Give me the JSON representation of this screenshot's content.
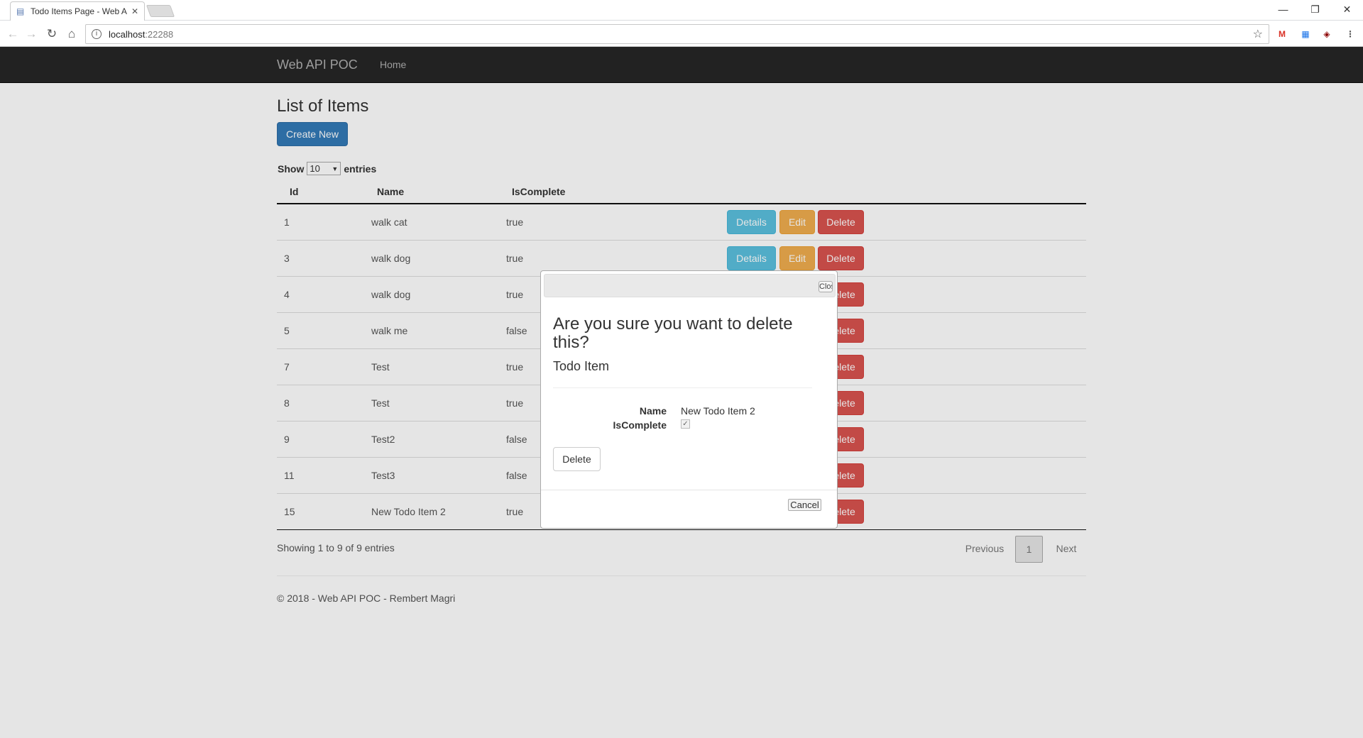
{
  "browser": {
    "tab_title": "Todo Items Page - Web A",
    "tab_close": "✕",
    "url_host": "localhost",
    "url_port": ":22288",
    "window_controls": [
      "—",
      "❐",
      "✕"
    ],
    "extensions": [
      {
        "name": "gmail-icon",
        "glyph": "M",
        "color": "#d93025"
      },
      {
        "name": "calendar-icon",
        "glyph": "▦",
        "color": "#1a73e8"
      },
      {
        "name": "ublock-icon",
        "glyph": "◈",
        "color": "#8b0000"
      },
      {
        "name": "menu-icon",
        "glyph": "⋮",
        "color": "#555555"
      }
    ]
  },
  "navbar": {
    "brand": "Web API POC",
    "home": "Home"
  },
  "page": {
    "title": "List of Items",
    "create_button": "Create New",
    "show_label": "Show",
    "show_value": "10",
    "entries_label": "entries",
    "columns": [
      "Id",
      "Name",
      "IsComplete"
    ],
    "rows": [
      {
        "id": "1",
        "name": "walk cat",
        "complete": "true"
      },
      {
        "id": "3",
        "name": "walk dog",
        "complete": "true"
      },
      {
        "id": "4",
        "name": "walk dog",
        "complete": "true"
      },
      {
        "id": "5",
        "name": "walk me",
        "complete": "false"
      },
      {
        "id": "7",
        "name": "Test",
        "complete": "true"
      },
      {
        "id": "8",
        "name": "Test",
        "complete": "true"
      },
      {
        "id": "9",
        "name": "Test2",
        "complete": "false"
      },
      {
        "id": "11",
        "name": "Test3",
        "complete": "false"
      },
      {
        "id": "15",
        "name": "New Todo Item 2",
        "complete": "true"
      }
    ],
    "row_actions": {
      "details": "Details",
      "edit": "Edit",
      "delete": "Delete"
    },
    "info": "Showing 1 to 9 of 9 entries",
    "pager": {
      "previous": "Previous",
      "page": "1",
      "next": "Next"
    },
    "footer": "© 2018 - Web API POC - Rembert Magri"
  },
  "modal": {
    "close_label": "Close",
    "question": "Are you sure you want to delete this?",
    "subtitle": "Todo Item",
    "name_label": "Name",
    "name_value": "New Todo Item 2",
    "iscomplete_label": "IsComplete",
    "iscomplete_checked": true,
    "delete_button": "Delete",
    "cancel_button": "Cancel"
  }
}
